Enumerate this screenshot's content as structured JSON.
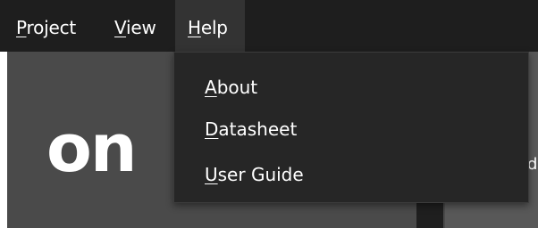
{
  "menubar": {
    "project": {
      "mnemonic": "P",
      "rest": "roject"
    },
    "view": {
      "mnemonic": "V",
      "rest": "iew"
    },
    "help": {
      "mnemonic": "H",
      "rest": "elp"
    }
  },
  "help_menu": {
    "items": [
      {
        "mnemonic": "A",
        "rest": "bout"
      },
      {
        "mnemonic": "D",
        "rest": "atasheet"
      },
      {
        "mnemonic": "U",
        "rest": "ser Guide"
      }
    ]
  },
  "background": {
    "logo_partial_text": "on",
    "panel_partial_text": "d"
  },
  "colors": {
    "menubar_bg": "#1e1e1e",
    "menu_active_bg": "#333333",
    "dropdown_bg": "#262626",
    "content_bg": "#4a4a4a",
    "text": "#ffffff"
  }
}
